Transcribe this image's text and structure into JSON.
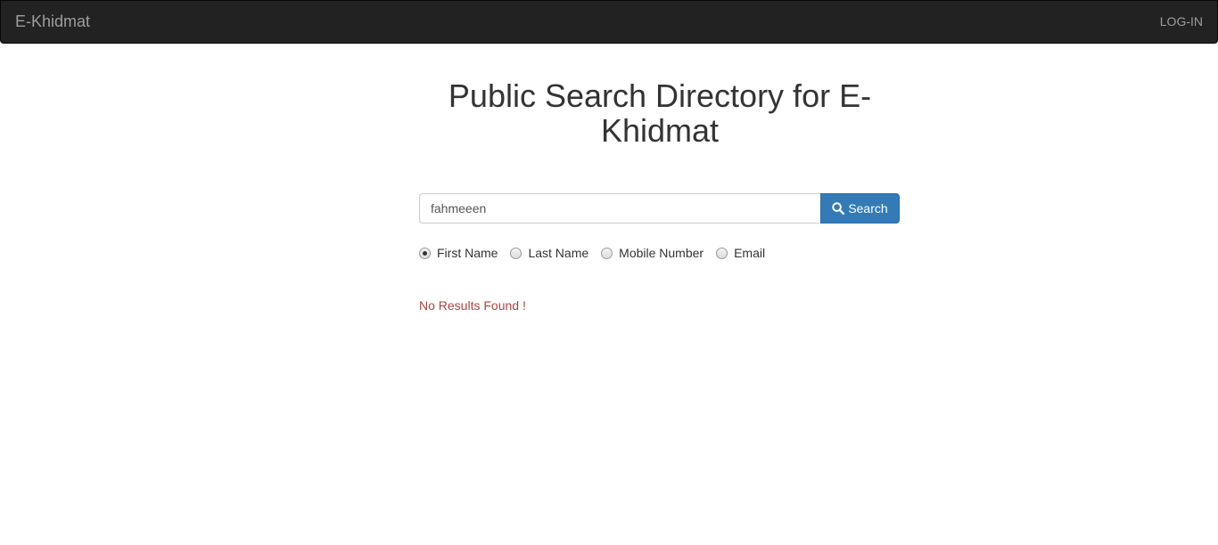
{
  "navbar": {
    "brand": "E-Khidmat",
    "login": "LOG-IN",
    "background_color": "#222222"
  },
  "main": {
    "title": "Public Search Directory for E-Khidmat",
    "search": {
      "value": "fahmeeen",
      "button_label": "Search",
      "button_icon": "search-icon",
      "button_color": "#337ab7"
    },
    "search_by": {
      "options": [
        {
          "label": "First Name",
          "checked": true
        },
        {
          "label": "Last Name",
          "checked": false
        },
        {
          "label": "Mobile Number",
          "checked": false
        },
        {
          "label": "Email",
          "checked": false
        }
      ]
    },
    "message": "No Results Found !",
    "message_color": "#a94442"
  }
}
